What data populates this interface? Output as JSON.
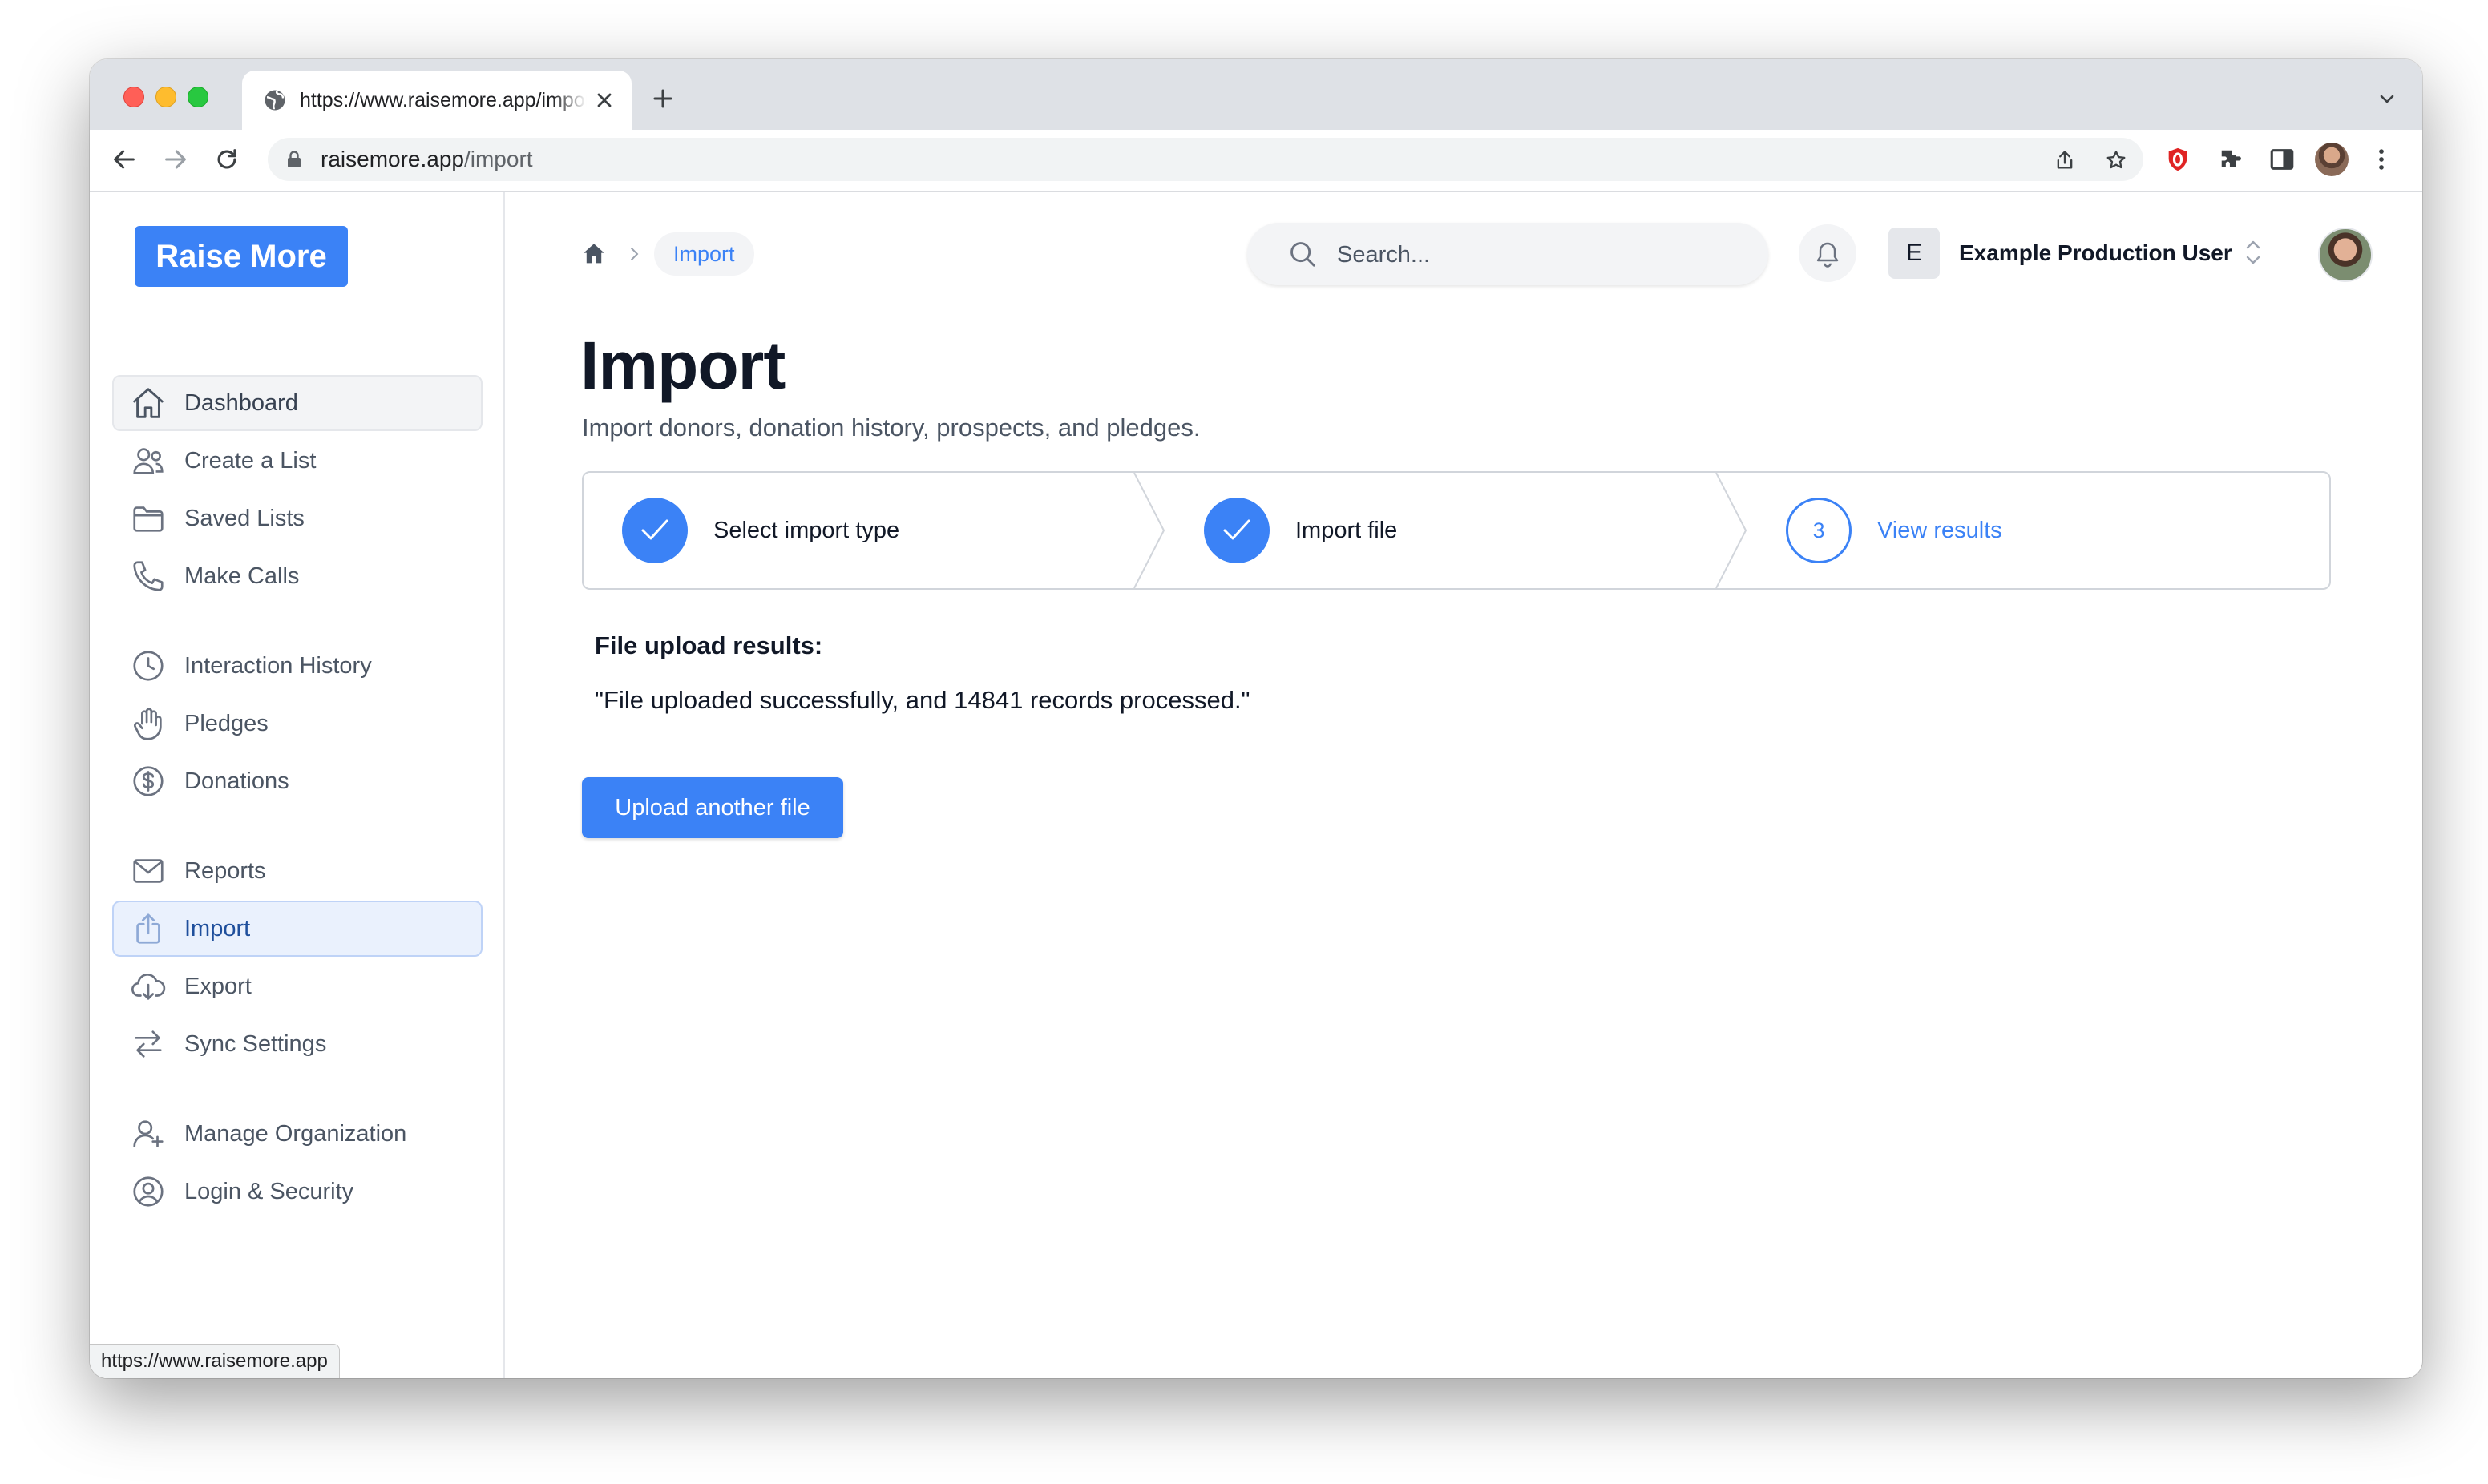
{
  "browser": {
    "tab_title": "https://www.raisemore.app/import",
    "url_host": "raisemore.app",
    "url_path": "/import",
    "status_url": "https://www.raisemore.app"
  },
  "brand": {
    "name": "Raise More",
    "accent": "#3b82f6"
  },
  "sidebar": {
    "items": [
      {
        "label": "Dashboard",
        "icon": "home-icon"
      },
      {
        "label": "Create a List",
        "icon": "users-icon"
      },
      {
        "label": "Saved Lists",
        "icon": "folder-icon"
      },
      {
        "label": "Make Calls",
        "icon": "phone-icon"
      },
      {
        "label": "Interaction History",
        "icon": "clock-icon"
      },
      {
        "label": "Pledges",
        "icon": "hand-icon"
      },
      {
        "label": "Donations",
        "icon": "dollar-icon"
      },
      {
        "label": "Reports",
        "icon": "mail-icon"
      },
      {
        "label": "Import",
        "icon": "upload-icon"
      },
      {
        "label": "Export",
        "icon": "cloud-download-icon"
      },
      {
        "label": "Sync Settings",
        "icon": "arrows-icon"
      },
      {
        "label": "Manage Organization",
        "icon": "user-plus-icon"
      },
      {
        "label": "Login & Security",
        "icon": "user-circle-icon"
      }
    ],
    "active": "Import"
  },
  "header": {
    "breadcrumb": "Import",
    "search_placeholder": "Search...",
    "org_initial": "E",
    "org_name": "Example Production User"
  },
  "main": {
    "title": "Import",
    "subtitle": "Import donors, donation history, prospects, and pledges.",
    "steps": [
      {
        "label": "Select import type",
        "state": "complete"
      },
      {
        "label": "Import file",
        "state": "complete"
      },
      {
        "label": "View results",
        "state": "current",
        "number": "3"
      }
    ],
    "results_heading": "File upload results:",
    "results_text": "\"File uploaded successfully, and 14841 records processed.\"",
    "upload_button": "Upload another file"
  }
}
